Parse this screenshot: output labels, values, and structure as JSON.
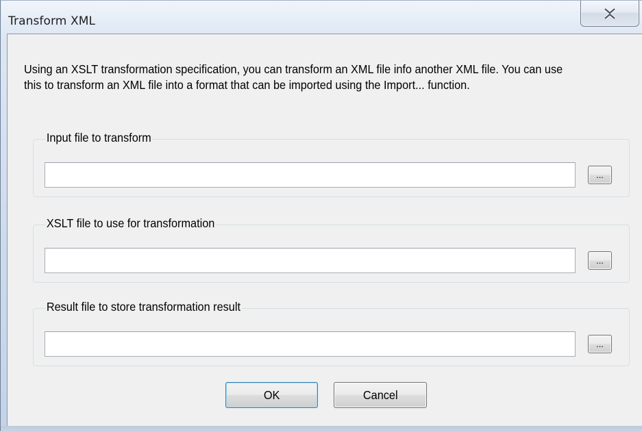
{
  "window": {
    "title": "Transform XML"
  },
  "dialog": {
    "description": "Using an XSLT transformation specification, you can transform an XML file info another XML file. You can use this to transform an XML file into a format that can be imported using the Import... function.",
    "groups": [
      {
        "label": "Input file to transform",
        "value": "",
        "browse_label": "..."
      },
      {
        "label": "XSLT file to use for transformation",
        "value": "",
        "browse_label": "..."
      },
      {
        "label": "Result file to store transformation result",
        "value": "",
        "browse_label": "..."
      }
    ],
    "ok_label": "OK",
    "cancel_label": "Cancel"
  },
  "icons": {
    "close": "close-icon"
  },
  "colors": {
    "dialog_background": "#f0f0f0",
    "default_button_border": "#3c7fb1"
  }
}
